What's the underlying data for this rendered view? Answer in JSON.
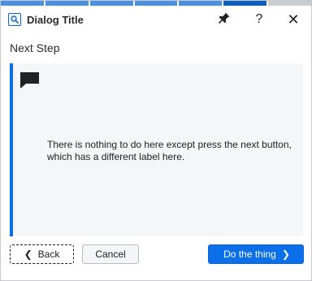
{
  "window": {
    "title": "Dialog Title",
    "icons": {
      "app": "search-icon",
      "pin": "pin-icon",
      "help": "help-icon",
      "close": "close-icon"
    },
    "help_glyph": "?",
    "close_glyph": "✕"
  },
  "progress": {
    "total_steps": 7,
    "completed_steps": 5,
    "current_step": 6
  },
  "step": {
    "heading": "Next Step",
    "icon": "comment-icon",
    "message": "There is nothing to do here except press the next button, which has a different label here."
  },
  "buttons": {
    "back_label": "Back",
    "cancel_label": "Cancel",
    "next_label": "Do the thing",
    "back_glyph": "❮",
    "next_glyph": "❯"
  },
  "colors": {
    "accent": "#0a6fe8",
    "progress_done": "#4a90e2",
    "progress_current": "#0a5ec6",
    "progress_todo": "#c9ccd0",
    "content_bg": "#f5f6f8"
  }
}
